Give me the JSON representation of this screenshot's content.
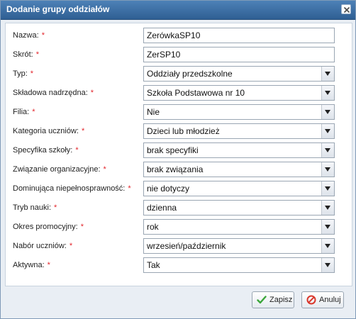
{
  "dialog": {
    "title": "Dodanie grupy oddziałów"
  },
  "form": {
    "fields": [
      {
        "label": "Nazwa:",
        "required": "*",
        "type": "text",
        "value": "ZerówkaSP10"
      },
      {
        "label": "Skrót:",
        "required": "*",
        "type": "text",
        "value": "ZerSP10"
      },
      {
        "label": "Typ:",
        "required": "*",
        "type": "select",
        "value": "Oddziały przedszkolne"
      },
      {
        "label": "Składowa nadrzędna:",
        "required": "*",
        "type": "select",
        "value": "Szkoła Podstawowa nr 10"
      },
      {
        "label": "Filia:",
        "required": "*",
        "type": "select",
        "value": "Nie"
      },
      {
        "label": "Kategoria uczniów:",
        "required": "*",
        "type": "select",
        "value": "Dzieci lub młodzież"
      },
      {
        "label": "Specyfika szkoły:",
        "required": "*",
        "type": "select",
        "value": "brak specyfiki"
      },
      {
        "label": "Związanie organizacyjne:",
        "required": "*",
        "type": "select",
        "value": "brak związania"
      },
      {
        "label": "Dominująca niepełnosprawność:",
        "required": "*",
        "type": "select",
        "value": "nie dotyczy"
      },
      {
        "label": "Tryb nauki:",
        "required": "*",
        "type": "select",
        "value": "dzienna"
      },
      {
        "label": "Okres promocyjny:",
        "required": "*",
        "type": "select",
        "value": "rok"
      },
      {
        "label": "Nabór uczniów:",
        "required": "*",
        "type": "select",
        "value": "wrzesień/październik"
      },
      {
        "label": "Aktywna:",
        "required": "*",
        "type": "select",
        "value": "Tak"
      }
    ]
  },
  "buttons": {
    "save": "Zapisz",
    "cancel": "Anuluj"
  },
  "colors": {
    "required": "#e3262c",
    "titlebar": "#3b6fa5"
  },
  "icons": {
    "close": "close-icon",
    "save": "checkmark-icon",
    "cancel": "no-entry-icon",
    "dropdown": "chevron-down-icon"
  }
}
